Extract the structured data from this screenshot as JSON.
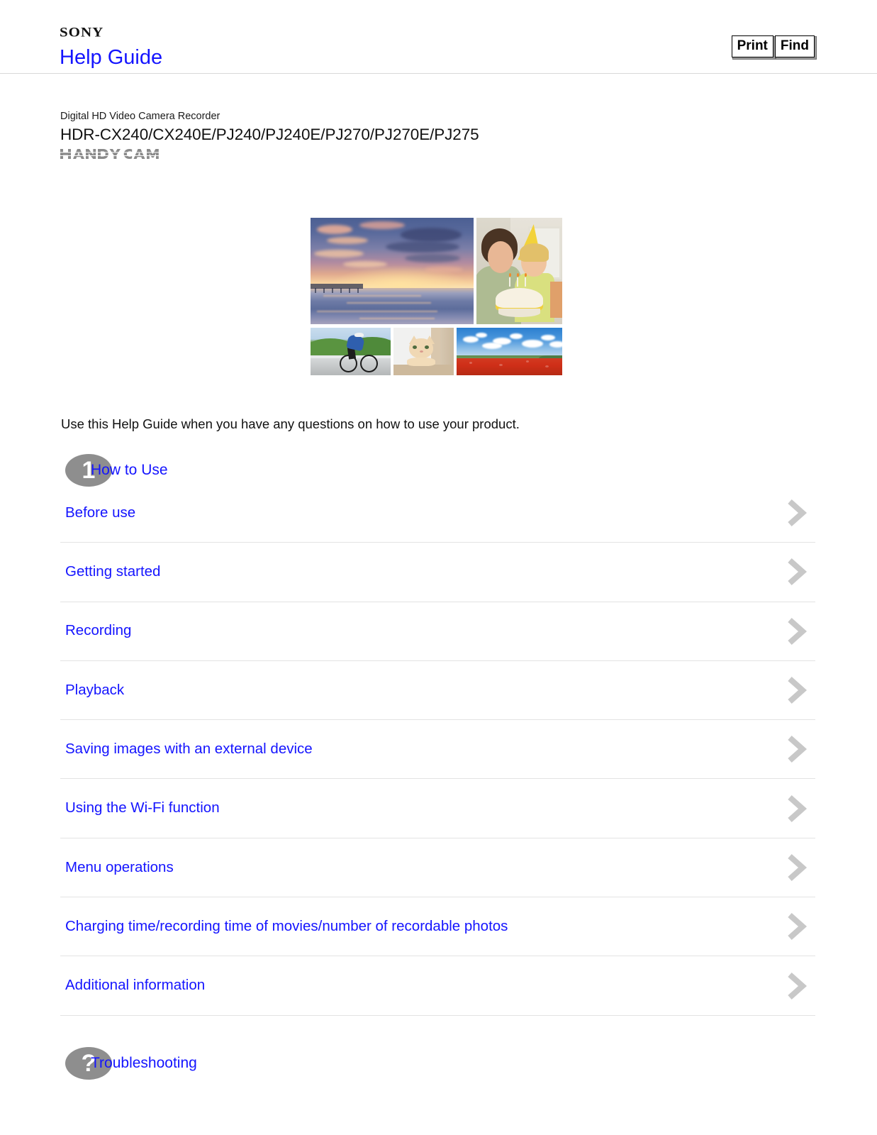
{
  "header": {
    "brand": "SONY",
    "title": "Help Guide",
    "print_button": "Print",
    "find_button": "Find"
  },
  "product": {
    "category": "Digital HD Video Camera Recorder",
    "model": "HDR-CX240/CX240E/PJ240/PJ240E/PJ270/PJ270E/PJ275",
    "series_logo": "HANDYCAM"
  },
  "collage": {
    "photos": [
      "sunset-beach-pier-photo",
      "birthday-party-photo",
      "cyclist-photo",
      "cat-photo",
      "poppy-field-photo"
    ]
  },
  "intro": "Use this Help Guide when you have any questions on how to use your product.",
  "sections": [
    {
      "badge": "1",
      "label": "How to Use",
      "items": [
        "Before use",
        "Getting started",
        "Recording",
        "Playback",
        "Saving images with an external device",
        "Using the Wi-Fi function",
        "Menu operations",
        "Charging time/recording time of movies/number of recordable photos",
        "Additional information"
      ]
    },
    {
      "badge": "?",
      "label": "Troubleshooting",
      "items": []
    }
  ],
  "colors": {
    "link": "#1414ff",
    "icon_gray": "#8e8e8e",
    "chevron_gray": "#c8c8c8",
    "divider": "#e3e3e3",
    "handycam_gray": "#8a8a8a"
  }
}
